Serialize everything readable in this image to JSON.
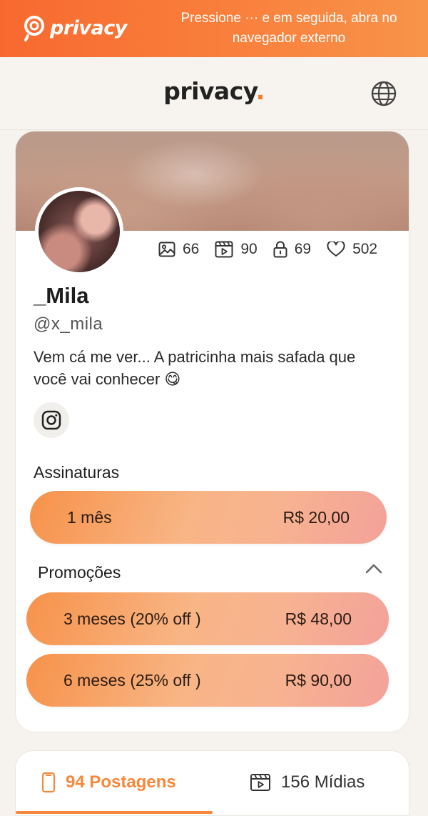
{
  "banner": {
    "logo_text": "privacy",
    "message": "Pressione ··· e em seguida, abra no navegador externo"
  },
  "header": {
    "brand": "privacy",
    "brand_dot": "."
  },
  "profile": {
    "stats": {
      "photos": "66",
      "videos": "90",
      "locked": "69",
      "likes": "502"
    },
    "name": "_Mila",
    "handle": "@x_mila",
    "bio": "Vem cá me ver... A patricinha mais safada que você vai conhecer 😋"
  },
  "subscriptions": {
    "title": "Assinaturas",
    "plan": {
      "label": "1 mês",
      "price": "R$ 20,00"
    }
  },
  "promotions": {
    "title": "Promoções",
    "plans": [
      {
        "label": "3 meses (20% off )",
        "price": "R$ 48,00"
      },
      {
        "label": "6 meses (25% off )",
        "price": "R$ 90,00"
      }
    ]
  },
  "tabs": [
    {
      "label": "94 Postagens",
      "active": true
    },
    {
      "label": "156 Mídias",
      "active": false
    }
  ],
  "colors": {
    "accent": "#f7873b",
    "banner": "#f8692f"
  }
}
